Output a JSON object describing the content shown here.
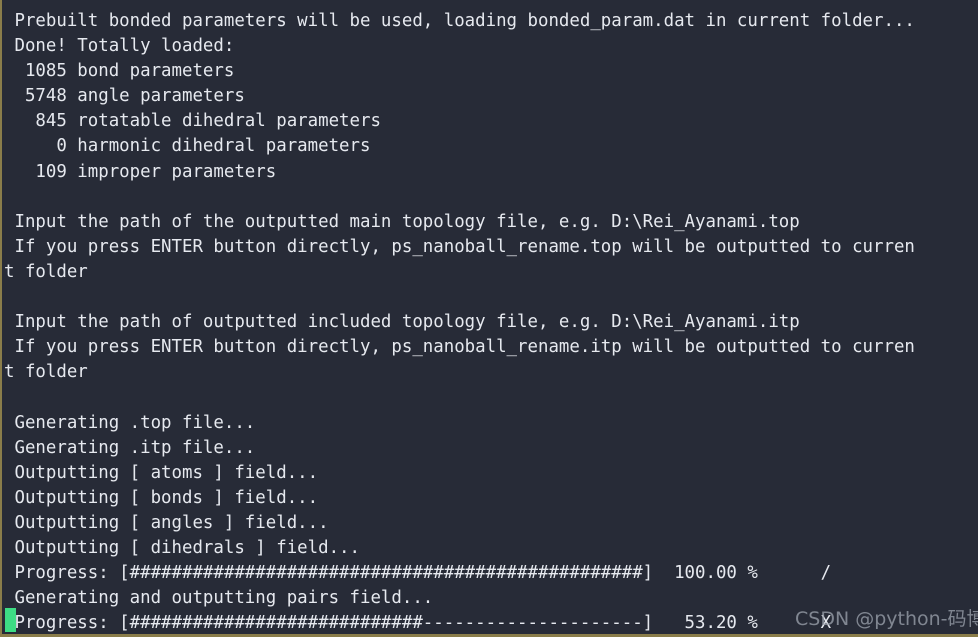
{
  "terminal": {
    "background_color": "#272b37",
    "text_color": "#e6e9ef",
    "cursor_color": "#3ddc84",
    "border_color": "#8a7d4a",
    "lines": [
      " Prebuilt bonded parameters will be used, loading bonded_param.dat in current folder...",
      " Done! Totally loaded:",
      "  1085 bond parameters",
      "  5748 angle parameters",
      "   845 rotatable dihedral parameters",
      "     0 harmonic dihedral parameters",
      "   109 improper parameters",
      "",
      " Input the path of the outputted main topology file, e.g. D:\\Rei_Ayanami.top",
      " If you press ENTER button directly, ps_nanoball_rename.top will be outputted to curren",
      "t folder",
      "",
      " Input the path of outputted included topology file, e.g. D:\\Rei_Ayanami.itp",
      " If you press ENTER button directly, ps_nanoball_rename.itp will be outputted to curren",
      "t folder",
      "",
      " Generating .top file...",
      " Generating .itp file...",
      " Outputting [ atoms ] field...",
      " Outputting [ bonds ] field...",
      " Outputting [ angles ] field...",
      " Outputting [ dihedrals ] field...",
      " Progress: [#################################################]  100.00 %      /",
      " Generating and outputting pairs field...",
      " Progress: [############################---------------------]   53.20 %      X"
    ]
  },
  "progress_bars": [
    {
      "label": "Progress:",
      "filled_chars": 49,
      "empty_chars": 0,
      "percent": "100.00 %",
      "spinner": "/"
    },
    {
      "label": "Progress:",
      "filled_chars": 28,
      "empty_chars": 21,
      "percent": "53.20 %",
      "spinner": "X"
    }
  ],
  "loaded_parameters": [
    {
      "count": "1085",
      "name": "bond parameters"
    },
    {
      "count": "5748",
      "name": "angle parameters"
    },
    {
      "count": "845",
      "name": "rotatable dihedral parameters"
    },
    {
      "count": "0",
      "name": "harmonic dihedral parameters"
    },
    {
      "count": "109",
      "name": "improper parameters"
    }
  ],
  "watermark": {
    "text": "CSDN @python-码博士"
  }
}
